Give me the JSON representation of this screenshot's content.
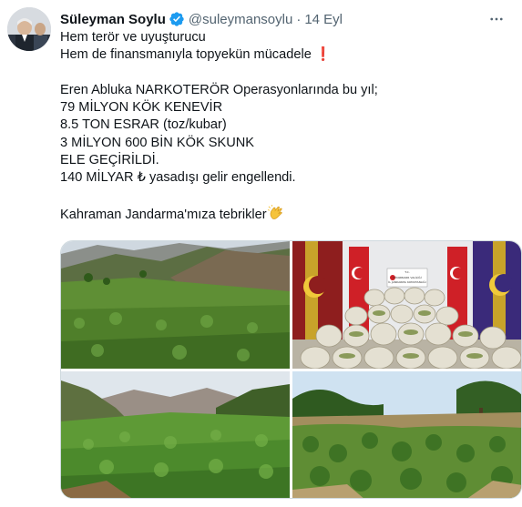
{
  "author": {
    "name": "Süleyman Soylu",
    "handle": "@suleymansoylu",
    "separator": "·",
    "date": "14 Eyl"
  },
  "tweet": {
    "line1": "Hem terör ve uyuşturucu",
    "line2": "Hem de finansmanıyla topyekün mücadele",
    "line2_emoji": "❗",
    "line3": "Eren Abluka NARKOTERÖR Operasyonlarında bu yıl;",
    "line4": "79 MİLYON KÖK KENEVİR",
    "line5": "8.5 TON ESRAR (toz/kubar)",
    "line6": "3 MİLYON 600 BİN KÖK SKUNK",
    "line7": "ELE GEÇİRİLDİ.",
    "line8": "140 MİLYAR ₺ yasadışı gelir engellendi.",
    "line9": "Kahraman Jandarma'mıza tebrikler"
  },
  "icons": {
    "verified": "verified-badge-icon",
    "more": "more-options-icon",
    "clap": "clapping-hands-icon"
  },
  "photos": [
    {
      "subject": "cannabis field on mountain slope"
    },
    {
      "subject": "seized sacks with Jandarma flags"
    },
    {
      "subject": "cannabis field in valley"
    },
    {
      "subject": "cannabis plants among trees"
    }
  ],
  "banner": {
    "line1": "T.C.",
    "line2": "DİYARBAKIR VALİLİĞİ",
    "line3": "İL JANDARMA KOMUTANLIĞI"
  },
  "colors": {
    "accent": "#1d9bf0",
    "text": "#0f1419",
    "muted": "#536471",
    "emoji_red": "#d9262e"
  }
}
